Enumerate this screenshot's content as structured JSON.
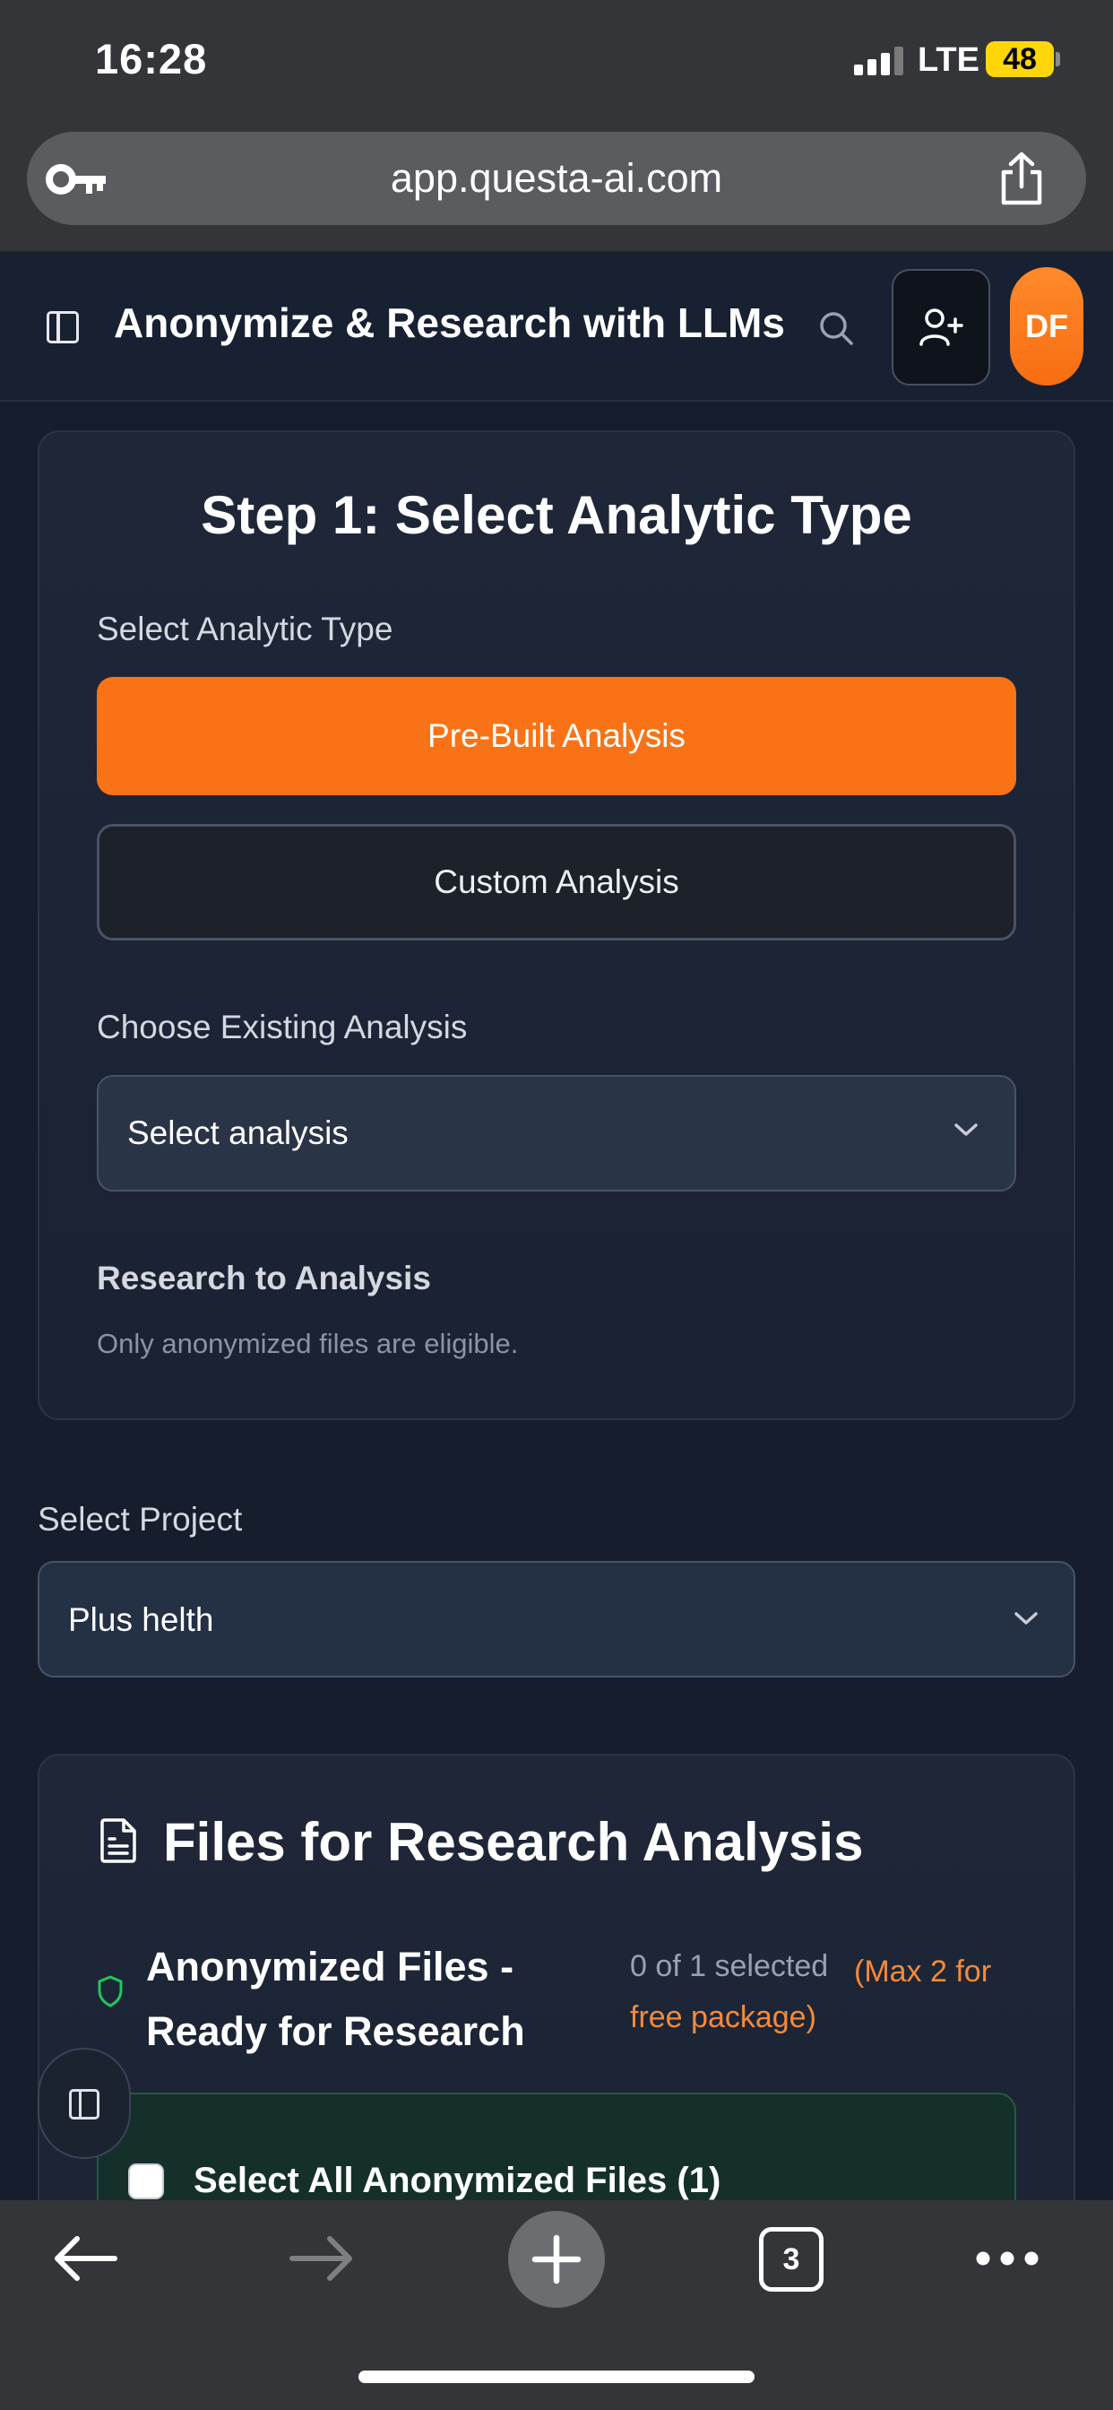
{
  "status_bar": {
    "time": "16:28",
    "network": "LTE",
    "battery": "48"
  },
  "browser": {
    "url": "app.questa-ai.com",
    "open_tabs": "3"
  },
  "header": {
    "title": "Anonymize & Research with LLMs",
    "avatar_initials": "DF"
  },
  "step1": {
    "title": "Step 1: Select Analytic Type",
    "type_label": "Select Analytic Type",
    "prebuilt_label": "Pre-Built Analysis",
    "custom_label": "Custom Analysis",
    "existing_label": "Choose Existing Analysis",
    "existing_value": "Select analysis",
    "research_label": "Research to Analysis",
    "research_helper": "Only anonymized files are eligible."
  },
  "project": {
    "label": "Select Project",
    "value": "Plus helth"
  },
  "files": {
    "title": "Files for Research Analysis",
    "section_title": "Anonymized Files - Ready for Research",
    "selected_count": "0 of 1 selected",
    "max_note": "(Max 2 for free package)",
    "select_all_label": "Select All Anonymized Files (1)"
  },
  "colors": {
    "accent": "#f97316",
    "background": "#161d2c",
    "card": "#1e2738",
    "success_border": "#245a3e"
  },
  "icons": {
    "lock": "key-icon",
    "share": "share-icon",
    "sidebar": "sidebar-toggle-icon",
    "search": "search-icon",
    "add_user": "user-plus-icon",
    "document": "document-icon",
    "shield": "shield-icon",
    "dropdown": "chevron-down-icon"
  }
}
